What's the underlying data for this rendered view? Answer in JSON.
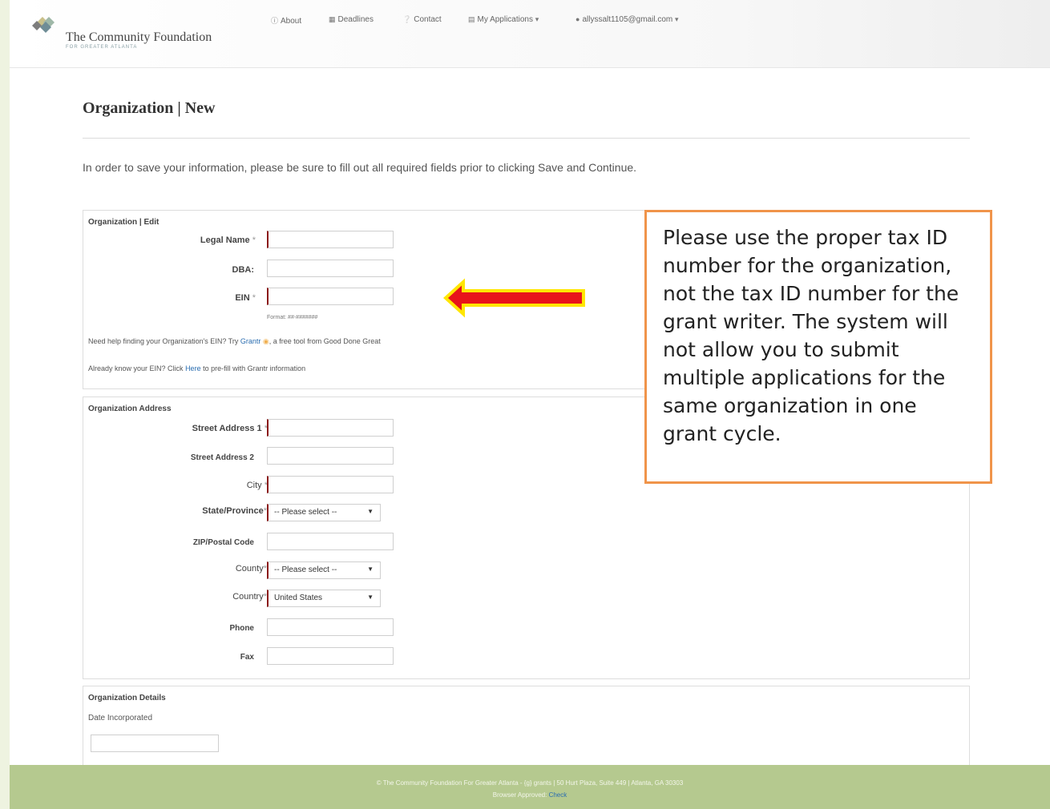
{
  "brand": {
    "name": "The Community Foundation",
    "tagline": "FOR GREATER ATLANTA"
  },
  "nav": {
    "about": "About",
    "deadlines": "Deadlines",
    "contact": "Contact",
    "my_applications": "My Applications",
    "user_email": "allyssalt1105@gmail.com"
  },
  "page": {
    "title": "Organization | New",
    "intro": "In order to save your information, please be sure to fill out all required fields prior to clicking Save and Continue."
  },
  "org_edit": {
    "title": "Organization | Edit",
    "legal_name_label": "Legal Name",
    "dba_label": "DBA:",
    "ein_label": "EIN",
    "format_hint": "Format: ##-#######",
    "help_prefix": "Need help finding your Organization's EIN?  Try",
    "help_link": "Grantr",
    "help_suffix": ", a free tool from Good Done Great",
    "prefill_prefix": "Already know your EIN? Click",
    "prefill_link": "Here",
    "prefill_suffix": "to pre-fill with Grantr information"
  },
  "address": {
    "title": "Organization Address",
    "street1_label": "Street Address 1",
    "street2_label": "Street Address 2",
    "city_label": "City",
    "state_label": "State/Province",
    "state_value": "-- Please select --",
    "zip_label": "ZIP/Postal Code",
    "county_label": "County",
    "county_value": "-- Please select --",
    "country_label": "Country",
    "country_value": "United States",
    "phone_label": "Phone",
    "fax_label": "Fax"
  },
  "details": {
    "title": "Organization Details",
    "date_incorporated_label": "Date Incorporated"
  },
  "required_marker": "*",
  "callout": {
    "text": "Please use the proper tax ID number for the organization, not the tax ID number for the grant writer. The system will not allow you to submit multiple applications for the same organization in one grant cycle."
  },
  "footer": {
    "line1": "© The Community Foundation For Greater Atlanta - {g} grants | 50 Hurt Plaza, Suite 449 | Atlanta, GA 30303",
    "line2_prefix": "Browser Approved:",
    "line2_link": "Check"
  },
  "icons": {
    "about": "info-circle-icon",
    "deadlines": "calendar-icon",
    "contact": "help-circle-icon",
    "my_applications": "folder-icon",
    "user": "user-icon",
    "arrow": "red-arrow-left-icon"
  },
  "colors": {
    "callout_border": "#f0944a",
    "required_border": "#8b1a1a",
    "footer": "#b5c98f",
    "arrow_fill": "#e8141b",
    "arrow_outline": "#ffe600"
  }
}
